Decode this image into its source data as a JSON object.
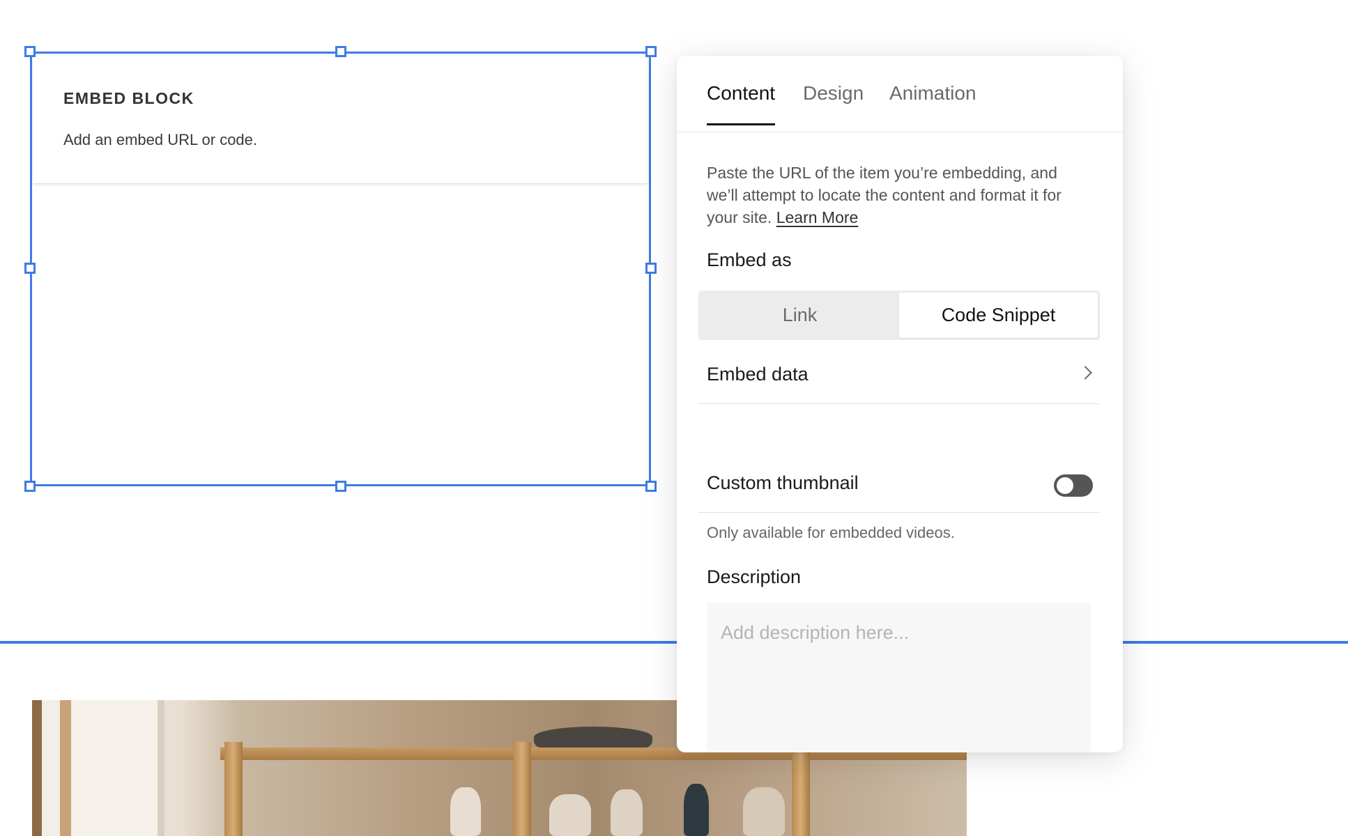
{
  "embed_block": {
    "title": "EMBED BLOCK",
    "subtitle": "Add an embed URL or code."
  },
  "panel": {
    "tabs": [
      {
        "label": "Content",
        "active": true
      },
      {
        "label": "Design",
        "active": false
      },
      {
        "label": "Animation",
        "active": false
      }
    ],
    "description_text": "Paste the URL of the item you’re embedding, and we’ll attempt to locate the content and format it for your site.",
    "learn_more": "Learn More",
    "embed_as_label": "Embed as",
    "embed_as_options": [
      "Link",
      "Code Snippet"
    ],
    "embed_as_selected": "Code Snippet",
    "embed_data_label": "Embed data",
    "custom_thumbnail_label": "Custom thumbnail",
    "custom_thumbnail_enabled": false,
    "custom_thumbnail_hint": "Only available for embedded videos.",
    "description_label": "Description",
    "description_placeholder": "Add description here...",
    "description_value": ""
  },
  "colors": {
    "selection_accent": "#3e7be3",
    "toggle_off": "#555555"
  },
  "icons": {
    "embed_data_arrow": "chevron-right-icon"
  }
}
